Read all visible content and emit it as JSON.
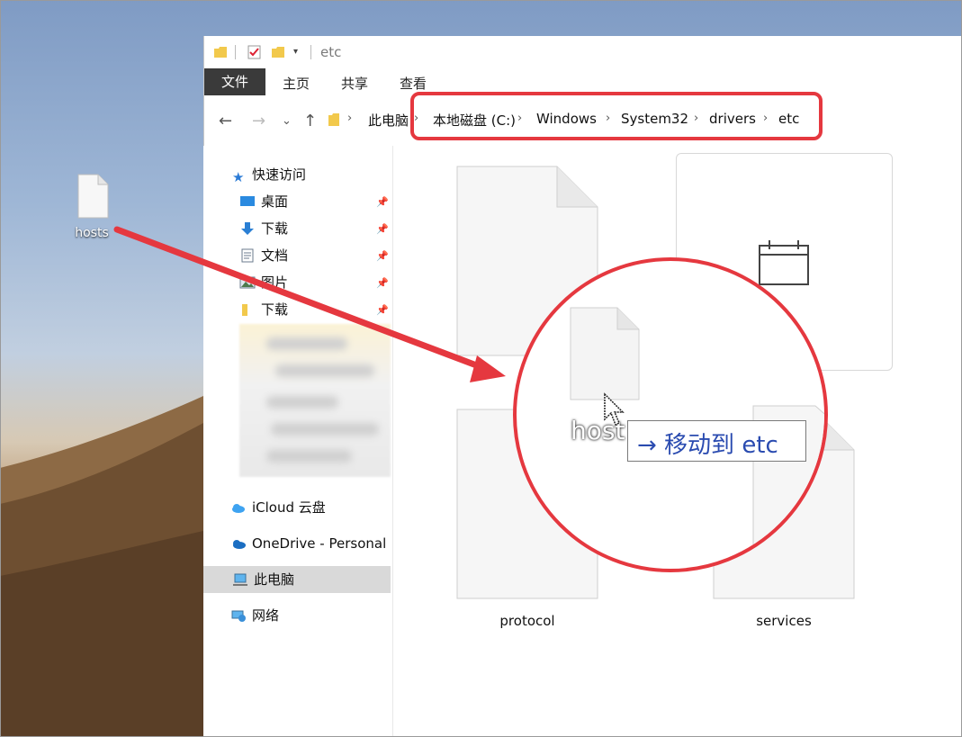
{
  "desktop": {
    "icon_label": "hosts"
  },
  "titlebar": {
    "title": "etc",
    "icons": [
      "folder-icon",
      "properties-check-icon",
      "new-folder-icon",
      "quick-access-dropdown-icon"
    ]
  },
  "ribbon": {
    "tabs": [
      "文件",
      "主页",
      "共享",
      "查看"
    ]
  },
  "address": {
    "crumbs": [
      "此电脑",
      "本地磁盘 (C:)",
      "Windows",
      "System32",
      "drivers",
      "etc"
    ]
  },
  "nav": {
    "quick_access": "快速访问",
    "items": [
      {
        "label": "桌面",
        "icon": "desktop-icon",
        "pinned": true
      },
      {
        "label": "下载",
        "icon": "download-arrow-icon",
        "pinned": true
      },
      {
        "label": "文档",
        "icon": "document-icon",
        "pinned": true
      },
      {
        "label": "图片",
        "icon": "pictures-icon",
        "pinned": true
      },
      {
        "label": "下载",
        "icon": "folder-icon",
        "pinned": true
      }
    ],
    "icloud": "iCloud 云盘",
    "onedrive": "OneDrive - Personal",
    "this_pc": "此电脑",
    "network": "网络"
  },
  "files": {
    "bottom_left": "protocol",
    "bottom_right": "services"
  },
  "magnifier": {
    "drag_label": "host",
    "tooltip": "→ 移动到 etc"
  },
  "colors": {
    "highlight": "#e5383f",
    "tooltip_text": "#2a4bb0",
    "ribbon_file_bg": "#3a3a3a"
  }
}
